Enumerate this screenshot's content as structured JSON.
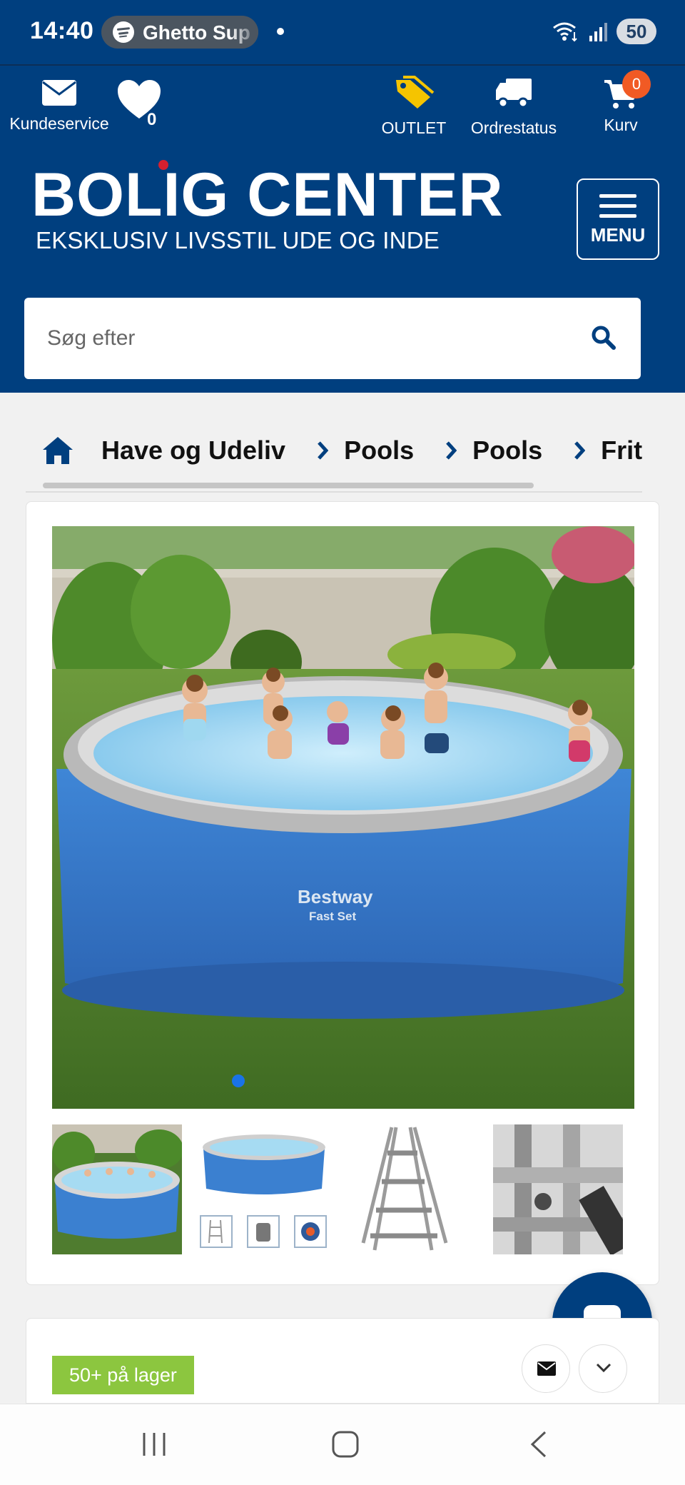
{
  "status_bar": {
    "time": "14:40",
    "now_playing": "Ghetto Sup",
    "battery": "50"
  },
  "header": {
    "customer_service": "Kundeservice",
    "wishlist_count": "0",
    "outlet": "OUTLET",
    "order_status": "Ordrestatus",
    "cart": "Kurv",
    "cart_count": "0",
    "logo_main": "BOLIG CENTER",
    "logo_sub": "EKSKLUSIV LIVSSTIL UDE OG INDE",
    "menu_label": "MENU",
    "search_placeholder": "Søg efter"
  },
  "breadcrumb": {
    "items": [
      "Have og Udeliv",
      "Pools",
      "Pools",
      "Frits"
    ]
  },
  "product": {
    "image_brand": "Bestway",
    "image_model": "Fast Set",
    "carousel_active_index": 0,
    "stock_label": "50+ på lager"
  },
  "colors": {
    "brand_blue": "#003f7f",
    "cart_badge": "#f15a24",
    "stock_green": "#8cc63f",
    "carousel_dot": "#1a73e8"
  }
}
